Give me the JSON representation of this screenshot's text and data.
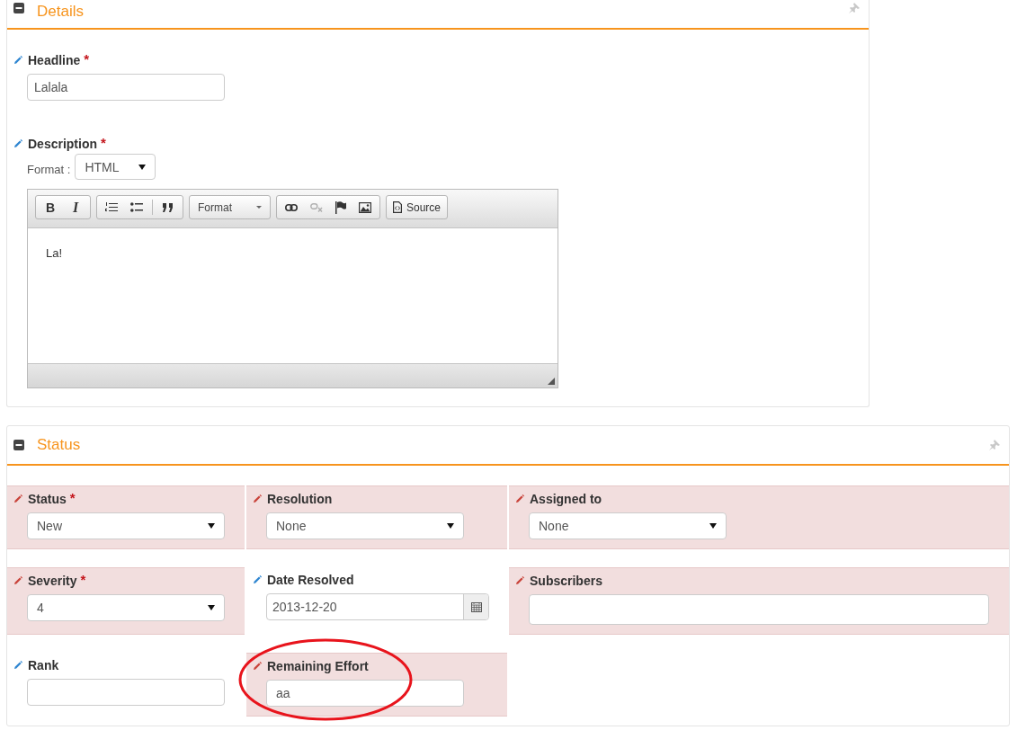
{
  "details": {
    "title": "Details",
    "expanded": true,
    "headline": {
      "label": "Headline",
      "required_mark": "*",
      "value": "Lalala"
    },
    "description": {
      "label": "Description",
      "required_mark": "*",
      "format_label": "Format :",
      "format_value": "HTML",
      "toolbar": {
        "bold": "B",
        "italic": "I",
        "format": "Format",
        "source": "Source",
        "unlink_disabled": true
      },
      "content": "La!"
    }
  },
  "status": {
    "title": "Status",
    "expanded": true,
    "fields": [
      {
        "label": "Status",
        "kind": "select",
        "value": "New",
        "required_mark": "*",
        "highlighted": true,
        "circled": false
      },
      {
        "label": "Resolution",
        "kind": "select",
        "value": "None",
        "highlighted": true,
        "circled": false
      },
      {
        "label": "Assigned to",
        "kind": "select",
        "value": "None",
        "highlighted": true,
        "circled": false
      },
      {
        "label": "Severity",
        "kind": "select",
        "value": "4",
        "required_mark": "*",
        "highlighted": true,
        "circled": false
      },
      {
        "label": "Date Resolved",
        "kind": "date",
        "value": "2013-12-20",
        "highlighted": false,
        "circled": false
      },
      {
        "label": "Subscribers",
        "kind": "wide",
        "highlighted": true,
        "circled": false
      },
      {
        "label": "Rank",
        "kind": "text",
        "highlighted": false,
        "circled": false
      },
      {
        "label": "Remaining Effort",
        "kind": "text",
        "value": "aa",
        "highlighted": true,
        "circled": true
      }
    ]
  }
}
